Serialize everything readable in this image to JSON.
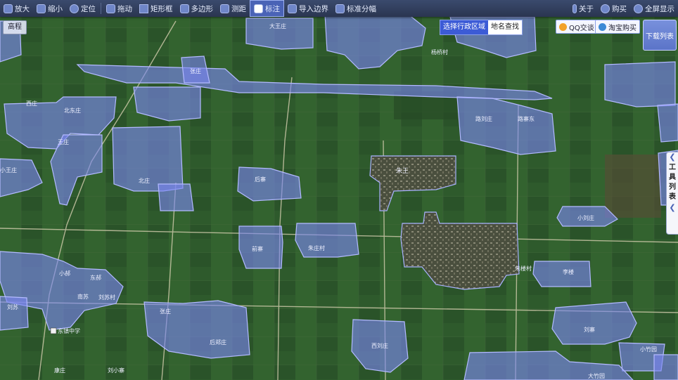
{
  "toolbar": {
    "items": [
      {
        "label": "放大",
        "icon": "zoom-in-icon"
      },
      {
        "label": "缩小",
        "icon": "zoom-out-icon"
      },
      {
        "label": "定位",
        "icon": "locate-icon"
      },
      {
        "label": "拖动",
        "icon": "pan-icon"
      },
      {
        "label": "矩形框",
        "icon": "rectangle-icon"
      },
      {
        "label": "多边形",
        "icon": "polygon-icon"
      },
      {
        "label": "测距",
        "icon": "ruler-icon"
      },
      {
        "label": "标注",
        "icon": "annotate-icon"
      },
      {
        "label": "导入边界",
        "icon": "import-boundary-icon"
      },
      {
        "label": "标准分幅",
        "icon": "grid-sheet-icon"
      }
    ],
    "active_index": 7,
    "right_items": [
      {
        "label": "关于",
        "icon": "info-icon"
      },
      {
        "label": "购买",
        "icon": "purchase-icon"
      },
      {
        "label": "全屏显示",
        "icon": "fullscreen-icon"
      }
    ]
  },
  "highlight_button": "高程",
  "search_tabs": {
    "tabs": [
      "选择行政区域",
      "地名查找"
    ],
    "active_index": 0
  },
  "share": {
    "qq": "QQ交谈",
    "taobao": "淘宝购买"
  },
  "download_list": "下载列表",
  "side_panel": {
    "text": [
      "工",
      "具",
      "列",
      "表"
    ]
  },
  "colors": {
    "overlay_fill": "#7b86f0",
    "overlay_stroke": "#a9b2ff",
    "toolbar_bg": "#34426a",
    "accent": "#3c5bd6"
  },
  "place_labels": [
    {
      "name": "大王庄"
    },
    {
      "name": "杨桥村"
    },
    {
      "name": "西庄"
    },
    {
      "name": "张庄"
    },
    {
      "name": "北东庄"
    },
    {
      "name": "王庄"
    },
    {
      "name": "小王庄"
    },
    {
      "name": "北庄"
    },
    {
      "name": "后寨"
    },
    {
      "name": "朱王"
    },
    {
      "name": "路刘庄"
    },
    {
      "name": "路寨东"
    },
    {
      "name": "小刘庄"
    },
    {
      "name": "前寨"
    },
    {
      "name": "朱庄村"
    },
    {
      "name": "小郝"
    },
    {
      "name": "东郝"
    },
    {
      "name": "南苏"
    },
    {
      "name": "刘苏村"
    },
    {
      "name": "刘苏"
    },
    {
      "name": "朱楼村"
    },
    {
      "name": "李楼"
    },
    {
      "name": "张庄"
    },
    {
      "name": "东镇中学"
    },
    {
      "name": "后郑庄"
    },
    {
      "name": "西刘庄"
    },
    {
      "name": "刘寨"
    },
    {
      "name": "小竹园"
    },
    {
      "name": "康庄"
    },
    {
      "name": "刘小寨"
    },
    {
      "name": "大竹园"
    }
  ]
}
